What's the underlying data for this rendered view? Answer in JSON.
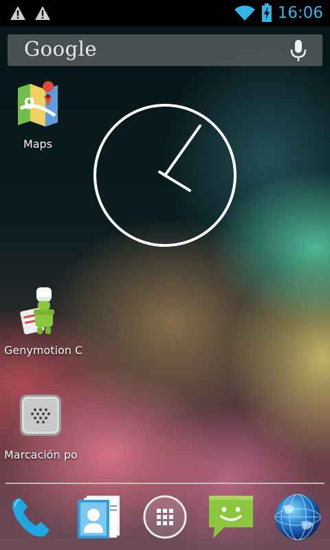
{
  "status_bar": {
    "time": "16:06",
    "notification_icons": [
      "warning-icon",
      "warning-icon"
    ],
    "system_icons": [
      "wifi-icon",
      "battery-charging-icon"
    ],
    "accent_color": "#33b5e5"
  },
  "search": {
    "logo_text": "Google",
    "voice_icon": "microphone-icon"
  },
  "home_apps": [
    {
      "label": "Maps",
      "icon": "maps-icon"
    },
    {
      "label": "Genymotion C",
      "icon": "genymotion-icon"
    },
    {
      "label": "Marcación po",
      "icon": "direct-dial-icon"
    }
  ],
  "clock_widget": {
    "type": "analog-clock",
    "hour": 16,
    "minute": 6
  },
  "dock": [
    {
      "icon": "phone-icon"
    },
    {
      "icon": "contacts-icon"
    },
    {
      "icon": "all-apps-icon"
    },
    {
      "icon": "messaging-icon"
    },
    {
      "icon": "browser-globe-icon"
    }
  ]
}
